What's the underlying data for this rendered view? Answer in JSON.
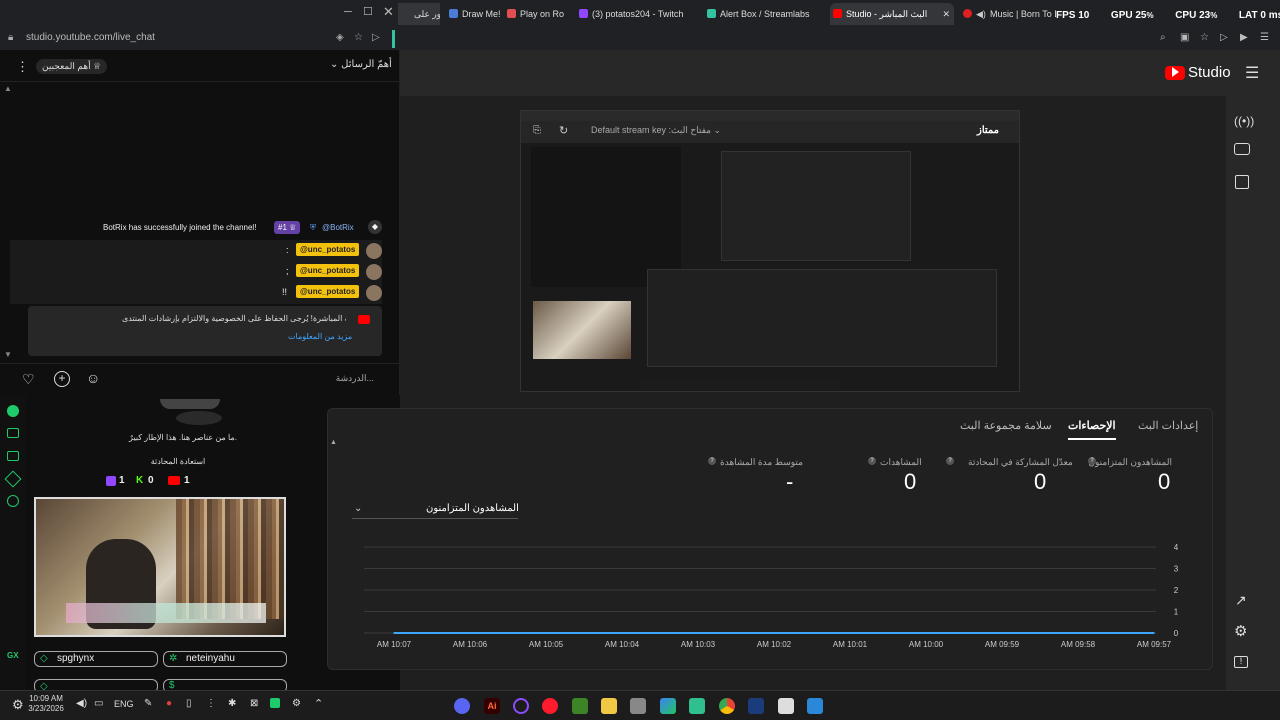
{
  "tabs": [
    {
      "label": "منشور على",
      "color": "#3c4043"
    },
    {
      "label": "Draw Me!",
      "color": "#4a7bd8"
    },
    {
      "label": "Play on Ro",
      "color": "#e05050"
    },
    {
      "label": "(3) potatos204 - Twitch",
      "color": "#9146ff"
    },
    {
      "label": "Alert Box / Streamlabs",
      "color": "#31c3a2"
    },
    {
      "label": "Studio - البث المباشر",
      "color": "#ff0000"
    },
    {
      "label": "Music | Born To Die",
      "color": "#e02020"
    }
  ],
  "overlay_stats": {
    "fps_label": "FPS",
    "fps_value": "10",
    "gpu_label": "GPU",
    "gpu_value": "25",
    "cpu_label": "CPU",
    "cpu_value": "23",
    "lat_label": "LAT",
    "lat_value": "0 ms"
  },
  "address": "studio.youtube.com/live_chat",
  "chat": {
    "filter_label": "أهمّ الرسائل",
    "top_fans_label": "أهم المعجبين",
    "botrix_message": "BotRix has successfully joined the channel!",
    "botrix_badge": "#1",
    "botrix_name": "@BotRix",
    "mentions": [
      {
        "name": "@unc_potatos",
        "text": ":"
      },
      {
        "name": "@unc_potatos",
        "text": ";"
      },
      {
        "name": "@unc_potatos",
        "text": "!!"
      }
    ],
    "notice_text": "أهلاً بك في الدردشة المباشرة! يُرجى الحفاظ على الخصوصية والالتزام بإرشادات المنتدى",
    "notice_link": "مزيد من المعلومات",
    "input_placeholder": "الدردشة..."
  },
  "widget": {
    "empty_text": "ما من عناصر هنا. هذا الإطار كبيرٌ.",
    "restore_label": "استعادة المحادثة",
    "twitch_count": "1",
    "kick_count": "0",
    "youtube_count": "1",
    "user1": "spghynx",
    "user2": "neteinyahu",
    "user4": "$"
  },
  "studio": {
    "brand": "Studio",
    "tabs": [
      "إعدادات البث",
      "الإحصاءات",
      "سلامة مجموعة البث"
    ],
    "active_tab": "الإحصاءات",
    "stats": [
      {
        "label": "المشاهدون المتزامنون",
        "value": "0"
      },
      {
        "label": "معدّل المشاركة في المحادثة",
        "value": "0"
      },
      {
        "label": "المشاهدات",
        "value": "0"
      },
      {
        "label": "متوسط مدة المشاهدة",
        "value": "-"
      }
    ],
    "chart_selector": "المشاهدون المتزامنون",
    "preview_title": "ممتاز",
    "preview_key_label": "مفتاح البث: Default stream key"
  },
  "chart_data": {
    "type": "line",
    "x": [
      "10:07 AM",
      "10:06 AM",
      "10:05 AM",
      "10:04 AM",
      "10:03 AM",
      "10:02 AM",
      "10:01 AM",
      "10:00 AM",
      "09:59 AM",
      "09:58 AM",
      "09:57 AM"
    ],
    "series": [
      {
        "values": [
          0,
          0,
          0,
          0,
          0,
          0,
          0,
          0,
          0,
          0,
          0
        ]
      }
    ],
    "ylim": [
      0,
      4
    ],
    "yticks": [
      "4",
      "3",
      "2",
      "1",
      "0"
    ],
    "grid": true
  },
  "taskbar": {
    "time": "10:09 AM",
    "date": "3/23/2026",
    "lang": "ENG"
  },
  "colors": {
    "accent_red": "#ff0000",
    "highlight_yellow": "#f4c20d",
    "twitch_purple": "#9146ff"
  }
}
